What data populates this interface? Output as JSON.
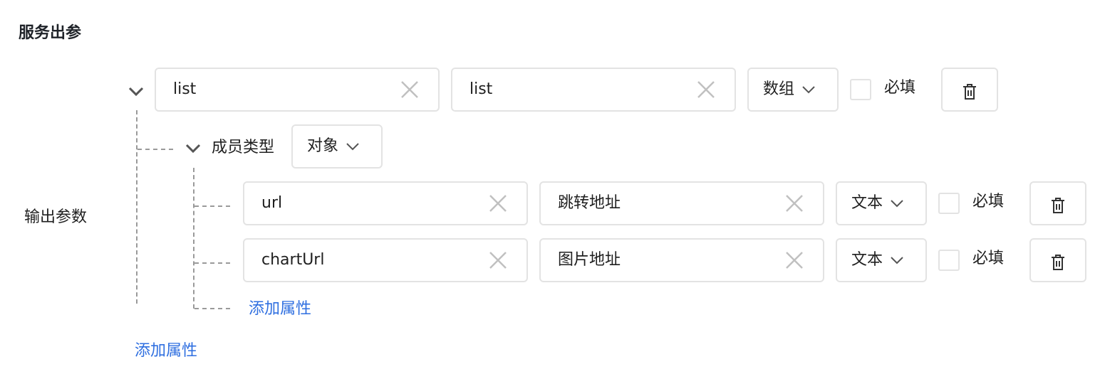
{
  "section_title": "服务出参",
  "side_label": "输出参数",
  "root_row": {
    "name": "list",
    "description": "list",
    "type": "数组",
    "required_label": "必填"
  },
  "member": {
    "label": "成员类型",
    "type": "对象"
  },
  "child_rows": [
    {
      "name": "url",
      "description": "跳转地址",
      "type": "文本",
      "required_label": "必填"
    },
    {
      "name": "chartUrl",
      "description": "图片地址",
      "type": "文本",
      "required_label": "必填"
    }
  ],
  "add_property_inner": "添加属性",
  "add_property_outer": "添加属性",
  "icons": {
    "clear": "close-icon",
    "dropdown": "chevron-down-icon",
    "delete": "trash-icon",
    "collapse": "chevron-down-icon"
  },
  "colors": {
    "border": "#e3e3e3",
    "link": "#2f6fe0",
    "icon_gray": "#c0c0c0",
    "connector": "#9a9a9a"
  }
}
